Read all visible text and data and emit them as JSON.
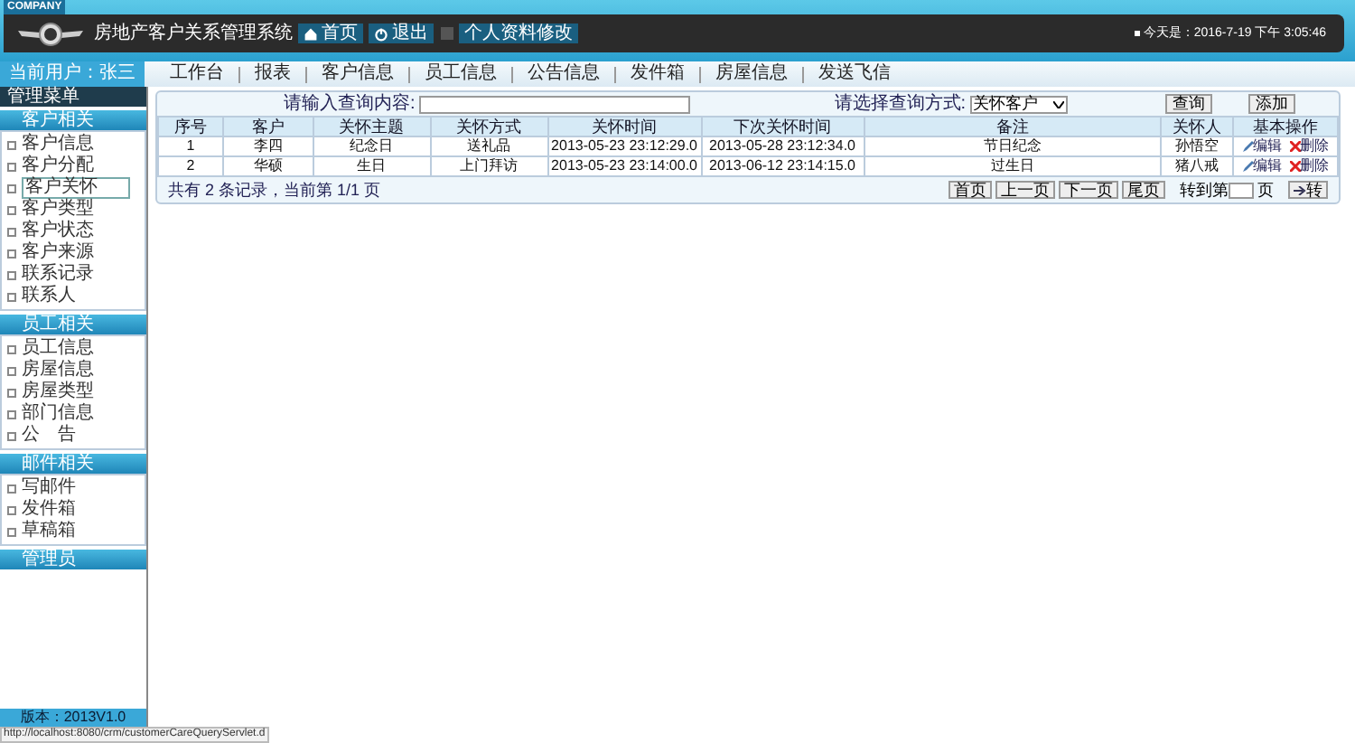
{
  "header": {
    "brand_tag": "COMPANY",
    "title": "房地产客户关系管理系统",
    "buttons": [
      {
        "label": "首页",
        "kind": "home"
      },
      {
        "label": "退出",
        "kind": "power"
      },
      {
        "label": "个人资料修改",
        "kind": "edit"
      }
    ],
    "date": "今天是：2016-7-19 下午 3:05:46"
  },
  "user": "当前用户：张三",
  "nav": [
    "工作台",
    "报表",
    "客户信息",
    "员工信息",
    "公告信息",
    "发件箱",
    "房屋信息",
    "发送飞信"
  ],
  "menu_title": "管理菜单",
  "menu": [
    {
      "label": "客户相关",
      "items": [
        {
          "label": "客户信息",
          "selected": false
        },
        {
          "label": "客户分配",
          "selected": false
        },
        {
          "label": "客户关怀",
          "selected": true
        },
        {
          "label": "客户类型",
          "selected": false
        },
        {
          "label": "客户状态",
          "selected": false
        },
        {
          "label": "客户来源",
          "selected": false
        },
        {
          "label": "联系记录",
          "selected": false
        },
        {
          "label": "联系人",
          "selected": false
        }
      ]
    },
    {
      "label": "员工相关",
      "items": [
        {
          "label": "员工信息",
          "selected": false
        },
        {
          "label": "房屋信息",
          "selected": false
        },
        {
          "label": "房屋类型",
          "selected": false
        },
        {
          "label": "部门信息",
          "selected": false
        },
        {
          "label": "公　告",
          "selected": false
        }
      ]
    },
    {
      "label": "邮件相关",
      "items": [
        {
          "label": "写邮件",
          "selected": false
        },
        {
          "label": "发件箱",
          "selected": false
        },
        {
          "label": "草稿箱",
          "selected": false
        }
      ]
    },
    {
      "label": "管理员"
    }
  ],
  "version": "版本：2013V1.0",
  "search": {
    "label": "请输入查询内容:",
    "mode_label": "请选择查询方式:",
    "mode": "关怀客户",
    "buttons": [
      "查询",
      "添加"
    ]
  },
  "table": {
    "columns": [
      "序号",
      "客户",
      "关怀主题",
      "关怀方式",
      "关怀时间",
      "下次关怀时间",
      "备注",
      "关怀人",
      "基本操作"
    ],
    "rows": [
      {
        "cells": [
          "1",
          "李四",
          "纪念日",
          "送礼品",
          "2013-05-23 23:12:29.0",
          "2013-05-28 23:12:34.0",
          "节日纪念",
          "孙悟空"
        ],
        "actions": [
          "编辑",
          "删除"
        ]
      },
      {
        "cells": [
          "2",
          "华硕",
          "生日",
          "上门拜访",
          "2013-05-23 23:14:00.0",
          "2013-06-12 23:14:15.0",
          "过生日",
          "猪八戒"
        ],
        "actions": [
          "编辑",
          "删除"
        ]
      }
    ]
  },
  "pager": {
    "summary": "共有 2 条记录，当前第 1/1 页",
    "buttons": [
      "首页",
      "上一页",
      "下一页",
      "尾页"
    ],
    "goto_before": "转到第",
    "goto_after": "页",
    "go": "转"
  },
  "status_url": "http://localhost:8080/crm/customerCareQueryServlet.d"
}
